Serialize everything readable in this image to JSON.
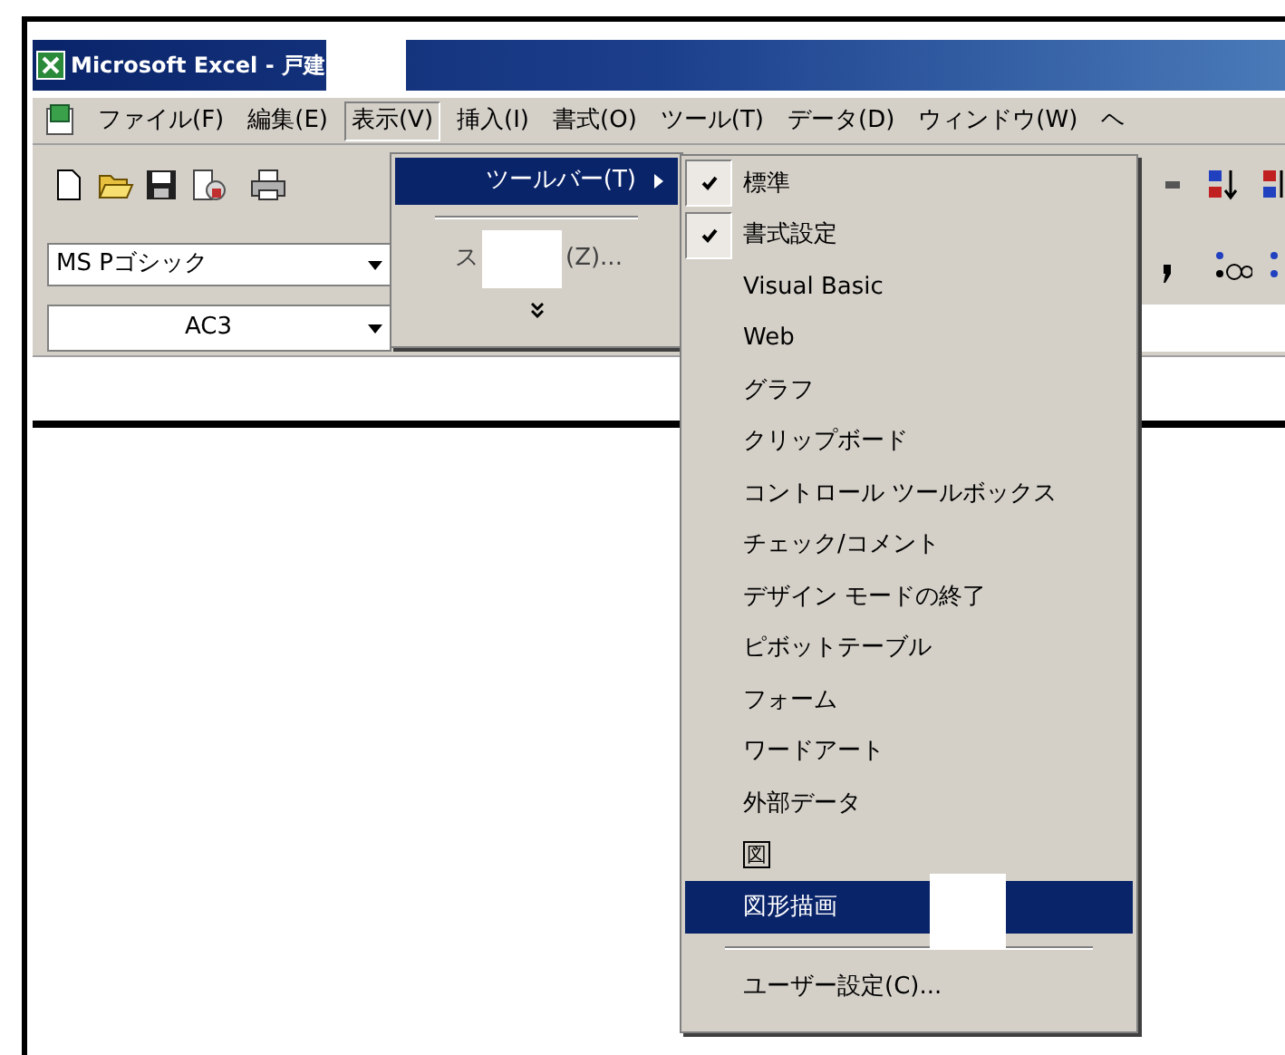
{
  "window": {
    "title": "Microsoft Excel - 戸建"
  },
  "menu_bar": [
    {
      "label": "ファイル(F)",
      "selected": false
    },
    {
      "label": "編集(E)",
      "selected": false
    },
    {
      "label": "表示(V)",
      "selected": true
    },
    {
      "label": "挿入(I)",
      "selected": false
    },
    {
      "label": "書式(O)",
      "selected": false
    },
    {
      "label": "ツール(T)",
      "selected": false
    },
    {
      "label": "データ(D)",
      "selected": false
    },
    {
      "label": "ウィンドウ(W)",
      "selected": false
    },
    {
      "label": "ヘ",
      "selected": false
    }
  ],
  "font_box": {
    "value": "MS Pゴシック"
  },
  "name_box": {
    "value": "AC3"
  },
  "view_menu": {
    "items": [
      {
        "kind": "submenu",
        "label": "ツールバー(T)",
        "selected": true
      },
      {
        "kind": "separator"
      },
      {
        "kind": "covered",
        "label_start": "ス",
        "label_end": "(Z)...",
        "selected": false
      },
      {
        "kind": "expand",
        "selected": false
      }
    ]
  },
  "toolbar_submenu": {
    "items": [
      {
        "kind": "text",
        "label": "標準",
        "checked": true,
        "selected": false
      },
      {
        "kind": "text",
        "label": "書式設定",
        "checked": true,
        "selected": false
      },
      {
        "kind": "text",
        "label": "Visual Basic",
        "checked": false,
        "selected": false
      },
      {
        "kind": "text",
        "label": "Web",
        "checked": false,
        "selected": false
      },
      {
        "kind": "text",
        "label": "グラフ",
        "checked": false,
        "selected": false
      },
      {
        "kind": "text",
        "label": "クリップボード",
        "checked": false,
        "selected": false
      },
      {
        "kind": "text",
        "label": "コントロール ツールボックス",
        "checked": false,
        "selected": false
      },
      {
        "kind": "text",
        "label": "チェック/コメント",
        "checked": false,
        "selected": false
      },
      {
        "kind": "text",
        "label": "デザイン モードの終了",
        "checked": false,
        "selected": false
      },
      {
        "kind": "text",
        "label": "ピボットテーブル",
        "checked": false,
        "selected": false
      },
      {
        "kind": "text",
        "label": "フォーム",
        "checked": false,
        "selected": false
      },
      {
        "kind": "text",
        "label": "ワードアート",
        "checked": false,
        "selected": false
      },
      {
        "kind": "text",
        "label": "外部データ",
        "checked": false,
        "selected": false
      },
      {
        "kind": "boxed",
        "label": "図",
        "checked": false,
        "selected": false
      },
      {
        "kind": "text",
        "label": "図形描画",
        "checked": false,
        "selected": true
      },
      {
        "kind": "separator"
      },
      {
        "kind": "text",
        "label": "ユーザー設定(C)...",
        "checked": false,
        "selected": false
      }
    ]
  }
}
